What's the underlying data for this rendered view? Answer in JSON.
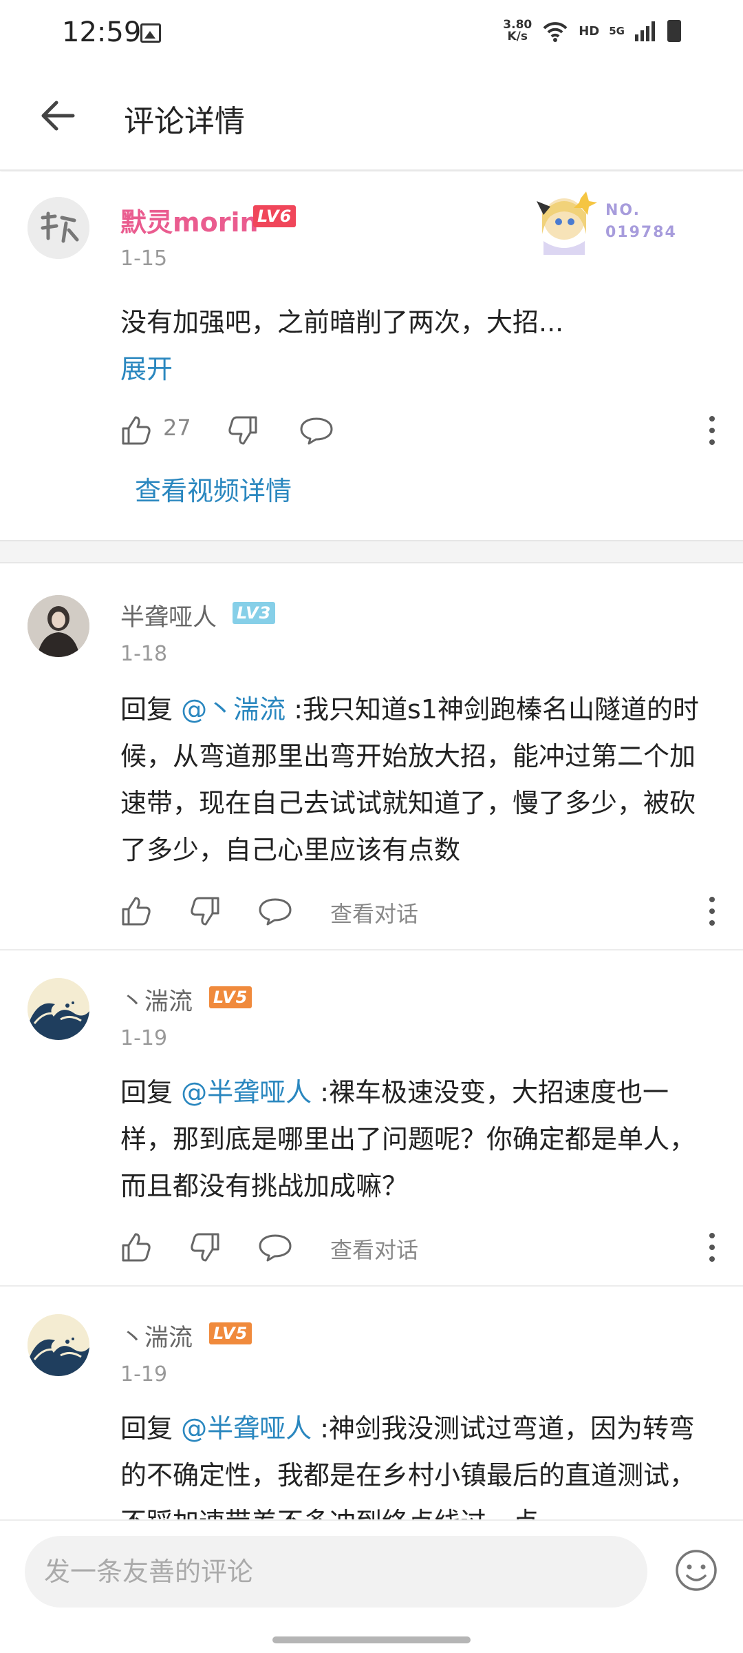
{
  "status_bar": {
    "time": "12:59",
    "net_speed_value": "3.80",
    "net_speed_unit": "K/s",
    "hd": "HD",
    "network": "5G"
  },
  "header": {
    "title": "评论详情"
  },
  "root_comment": {
    "username": "默灵morin",
    "level": "LV6",
    "date": "1-15",
    "text": "没有加强吧，之前暗削了两次，大招...",
    "expand_label": "展开",
    "like_count": "27",
    "video_link": "查看视频详情",
    "pendant_label_no": "NO.",
    "pendant_number": "019784"
  },
  "replies": [
    {
      "username": "半聋哑人",
      "level": "LV3",
      "date": "1-18",
      "reply_prefix": "回复 ",
      "mention": "@丶湍流",
      "text": " :我只知道s1神剑跑榛名山隧道的时候，从弯道那里出弯开始放大招，能冲过第二个加速带，现在自己去试试就知道了，慢了多少，被砍了多少，自己心里应该有点数",
      "view_conversation": "查看对话"
    },
    {
      "username": "丶湍流",
      "level": "LV5",
      "date": "1-19",
      "reply_prefix": "回复 ",
      "mention": "@半聋哑人",
      "text": " :裸车极速没变，大招速度也一样，那到底是哪里出了问题呢？你确定都是单人，而且都没有挑战加成嘛？",
      "view_conversation": "查看对话"
    },
    {
      "username": "丶湍流",
      "level": "LV5",
      "date": "1-19",
      "reply_prefix": "回复 ",
      "mention": "@半聋哑人",
      "text": " :神剑我没测试过弯道，因为转弯的不确定性，我都是在乡村小镇最后的直道测试，不踩加速带差不多冲到终点线过一点"
    }
  ],
  "bottom_bar": {
    "input_placeholder": "发一条友善的评论"
  },
  "colors": {
    "accent_blue": "#2a87bf",
    "username_pink": "#ea5c8f",
    "lv6": "#f0465a",
    "lv3": "#86cfe8",
    "lv5": "#f08a3c"
  }
}
